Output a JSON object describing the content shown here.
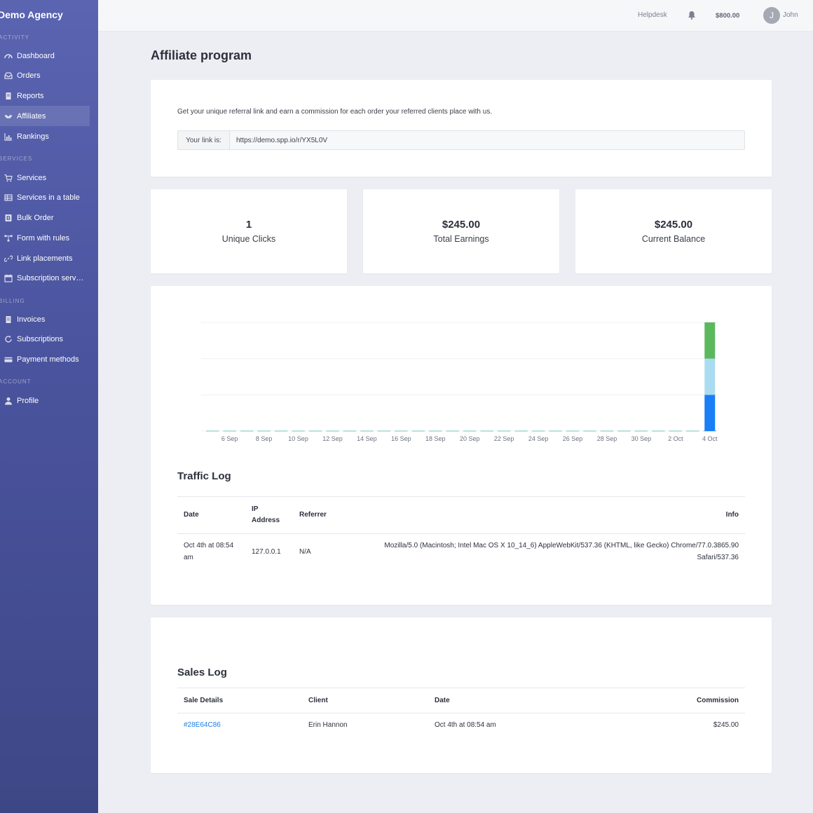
{
  "app": {
    "brand": "Demo Agency"
  },
  "sidebar": {
    "sections": [
      {
        "title": "ACTIVITY"
      },
      {
        "title": "SERVICES"
      },
      {
        "title": "BILLING"
      },
      {
        "title": "ACCOUNT"
      }
    ],
    "items": [
      {
        "label": "Dashboard",
        "icon": "dashboard-icon"
      },
      {
        "label": "Orders",
        "icon": "inbox-icon"
      },
      {
        "label": "Reports",
        "icon": "document-icon"
      },
      {
        "label": "Affiliates",
        "icon": "handshake-icon",
        "active": true
      },
      {
        "label": "Rankings",
        "icon": "bar-chart-icon"
      },
      {
        "label": "Services",
        "icon": "cart-icon"
      },
      {
        "label": "Services in a table",
        "icon": "table-icon"
      },
      {
        "label": "Bulk Order",
        "icon": "bold-icon"
      },
      {
        "label": "Form with rules",
        "icon": "flow-icon"
      },
      {
        "label": "Link placements",
        "icon": "link-icon"
      },
      {
        "label": "Subscription serv…",
        "icon": "calendar-icon"
      },
      {
        "label": "Invoices",
        "icon": "invoice-icon"
      },
      {
        "label": "Subscriptions",
        "icon": "refresh-icon"
      },
      {
        "label": "Payment methods",
        "icon": "credit-card-icon"
      },
      {
        "label": "Profile",
        "icon": "user-icon"
      }
    ]
  },
  "topbar": {
    "helpdesk": "Helpdesk",
    "balance": "$800.00",
    "avatar_initial": "J",
    "user_name": "John"
  },
  "page": {
    "title": "Affiliate program"
  },
  "referral": {
    "intro": "Get your unique referral link and earn a commission for each order your referred clients place with us.",
    "link_label": "Your link is:",
    "link_value": "https://demo.spp.io/r/YX5L0V"
  },
  "stats": [
    {
      "value": "1",
      "label": "Unique Clicks"
    },
    {
      "value": "$245.00",
      "label": "Total Earnings"
    },
    {
      "value": "$245.00",
      "label": "Current Balance"
    }
  ],
  "chart_data": {
    "type": "bar",
    "stacked": true,
    "grid": true,
    "x_tick_labels": [
      "6 Sep",
      "8 Sep",
      "10 Sep",
      "12 Sep",
      "14 Sep",
      "16 Sep",
      "18 Sep",
      "20 Sep",
      "22 Sep",
      "24 Sep",
      "26 Sep",
      "28 Sep",
      "30 Sep",
      "2 Oct",
      "4 Oct"
    ],
    "categories": [
      "5 Sep",
      "6 Sep",
      "7 Sep",
      "8 Sep",
      "9 Sep",
      "10 Sep",
      "11 Sep",
      "12 Sep",
      "13 Sep",
      "14 Sep",
      "15 Sep",
      "16 Sep",
      "17 Sep",
      "18 Sep",
      "19 Sep",
      "20 Sep",
      "21 Sep",
      "22 Sep",
      "23 Sep",
      "24 Sep",
      "25 Sep",
      "26 Sep",
      "27 Sep",
      "28 Sep",
      "29 Sep",
      "30 Sep",
      "1 Oct",
      "2 Oct",
      "3 Oct",
      "4 Oct"
    ],
    "series": [
      {
        "color": "#1a7ef5",
        "values": [
          0,
          0,
          0,
          0,
          0,
          0,
          0,
          0,
          0,
          0,
          0,
          0,
          0,
          0,
          0,
          0,
          0,
          0,
          0,
          0,
          0,
          0,
          0,
          0,
          0,
          0,
          0,
          0,
          0,
          1
        ]
      },
      {
        "color": "#a9dcf0",
        "values": [
          0,
          0,
          0,
          0,
          0,
          0,
          0,
          0,
          0,
          0,
          0,
          0,
          0,
          0,
          0,
          0,
          0,
          0,
          0,
          0,
          0,
          0,
          0,
          0,
          0,
          0,
          0,
          0,
          0,
          1
        ]
      },
      {
        "color": "#5cb85c",
        "values": [
          0,
          0,
          0,
          0,
          0,
          0,
          0,
          0,
          0,
          0,
          0,
          0,
          0,
          0,
          0,
          0,
          0,
          0,
          0,
          0,
          0,
          0,
          0,
          0,
          0,
          0,
          0,
          0,
          0,
          1
        ]
      }
    ],
    "ylim": [
      0,
      3
    ],
    "baseline_color": "#8fd0c8"
  },
  "traffic": {
    "title": "Traffic Log",
    "headers": {
      "date": "Date",
      "ip_line1": "IP",
      "ip_line2": "Address",
      "referrer": "Referrer",
      "info": "Info"
    },
    "rows": [
      {
        "date_line1": "Oct 4th at 08:54",
        "date_line2": "am",
        "ip": "127.0.0.1",
        "referrer": "N/A",
        "info_line1": "Mozilla/5.0 (Macintosh; Intel Mac OS X 10_14_6) AppleWebKit/537.36 (KHTML, like Gecko) Chrome/77.0.3865.90",
        "info_line2": "Safari/537.36"
      }
    ]
  },
  "sales": {
    "title": "Sales Log",
    "headers": {
      "details": "Sale Details",
      "client": "Client",
      "date": "Date",
      "commission": "Commission"
    },
    "rows": [
      {
        "id": "#28E64C86",
        "client": "Erin Hannon",
        "date": "Oct 4th at 08:54 am",
        "commission": "$245.00"
      }
    ]
  },
  "colors": {
    "sidebar_top": "#5a64b0",
    "sidebar_bottom": "#3e4786",
    "link": "#1a7ee6",
    "background": "#eceef3"
  }
}
